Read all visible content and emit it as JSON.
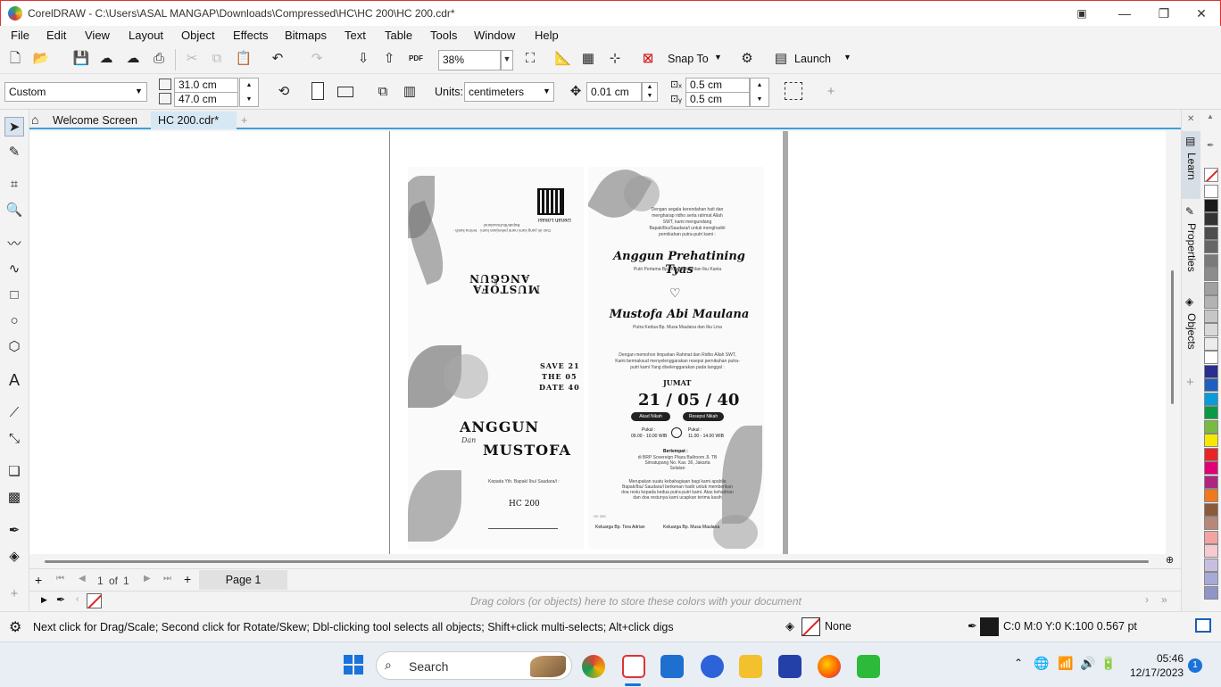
{
  "window": {
    "title": "CorelDRAW - C:\\Users\\ASAL MANGAP\\Downloads\\Compressed\\HC\\HC 200\\HC 200.cdr*",
    "icon": "coreldraw-app-icon"
  },
  "menu": [
    "File",
    "Edit",
    "View",
    "Layout",
    "Object",
    "Effects",
    "Bitmaps",
    "Text",
    "Table",
    "Tools",
    "Window",
    "Help"
  ],
  "toolbar": {
    "zoom": "38%",
    "snap_label": "Snap To",
    "launch_label": "Launch"
  },
  "propbar": {
    "page_size": "Custom",
    "width": "31.0 cm",
    "height": "47.0 cm",
    "units_label": "Units:",
    "units": "centimeters",
    "nudge": "0.01 cm",
    "dup_x": "0.5 cm",
    "dup_y": "0.5 cm"
  },
  "tabs": {
    "welcome": "Welcome Screen",
    "doc": "HC 200.cdr*"
  },
  "dock": {
    "learn": "Learn",
    "properties": "Properties",
    "objects": "Objects"
  },
  "pagenav": {
    "current": "1",
    "of": "of",
    "total": "1",
    "page_tab": "Page 1"
  },
  "docpalette": {
    "hint": "Drag colors (or objects) here to store these colors with your document"
  },
  "status": {
    "hint": "Next click for Drag/Scale; Second click for Rotate/Skew; Dbl-clicking tool selects all objects; Shift+click multi-selects; Alt+click digs",
    "fill": "None",
    "outline": "C:0 M:0 Y:0 K:100  0.567 pt"
  },
  "taskbar": {
    "search": "Search",
    "time": "05:46",
    "date": "12/17/2023",
    "badge": "1"
  },
  "palette": [
    "#ffffff",
    "#1a1a1a",
    "#333333",
    "#4d4d4d",
    "#666666",
    "#7a7a7a",
    "#8c8c8c",
    "#a0a0a0",
    "#b3b3b3",
    "#c6c6c6",
    "#d9d9d9",
    "#ececec",
    "#ffffff",
    "#2b2e8c",
    "#1f5fbf",
    "#0a9cd8",
    "#0a9a44",
    "#78bb3f",
    "#f4e800",
    "#e8262a",
    "#e10078",
    "#b0267f",
    "#f0781e",
    "#8a5a3c",
    "#b7887a",
    "#f4a3a3",
    "#f7c9d0",
    "#c8bfe0",
    "#a7a9d9",
    "#8f95c8"
  ],
  "invitation": {
    "top_left": {
      "name1": "ANGGUN",
      "amp": "&",
      "name2": "MUSTOFA",
      "qr_label": "Denah Lokasi"
    },
    "top_right": {
      "greeting": "Dengan segala kerendahan hati dan mengharap ridho serta rahmat Allah SWT, kami mengundang Bapak/Ibu/Saudara/i untuk menghadiri pernikahan putra-putri kami :",
      "bride": "Anggun Prehatining Tyas",
      "bride_parents": "Putri Pertama Bp. Tora Adrian dan Ibu Kania",
      "groom": "Mustofa Abi Maulana",
      "groom_parents": "Putra Kedua Bp. Musa Maulana dan Ibu Lina"
    },
    "bottom_left": {
      "save": "SAVE 21",
      "the": "THE 05",
      "date": "DATE 40",
      "name1": "ANGGUN",
      "dan": "Dan",
      "name2": "MUSTOFA",
      "to": "Kepada Yth. Bapak/ Ibu/ Saudara/i :",
      "code": "HC 200"
    },
    "bottom_right": {
      "intro": "Dengan memohon limpahan Rahmat dan Ridho Allah SWT, Kami bermaksud menyelenggarakan resepsi pernikahan putra-putri kami Yang diselenggarakan pada tanggal :",
      "day": "JUMAT",
      "date": "21 / 05 / 40",
      "akad": "Akad Nikah",
      "resepsi": "Resepsi Nikah",
      "pukul1": "Pukul :",
      "time1": "09.00 - 10.00 WIB",
      "pukul2": "Pukul :",
      "time2": "11.00 - 14.00 WIB",
      "venue_label": "Bertempat :",
      "venue": "di BRP Sovereign Plaza Ballroom Jl. TB Simatupang No. Kav. 36, Jakarta Selatan",
      "closing": "Merupakan suatu kebahagiaan bagi kami apabila Bapak/Ibu/ Saudara/i berkenan hadir untuk memberikan doa restu kepada kedua putra-putri kami. Atas kehadiran dan doa restunya kami ucapkan terima kasih",
      "family1": "Keluarga Bp. Tora Adrian",
      "family2": "Keluarga Bp. Musa Maulana",
      "code": "HC 200"
    }
  }
}
